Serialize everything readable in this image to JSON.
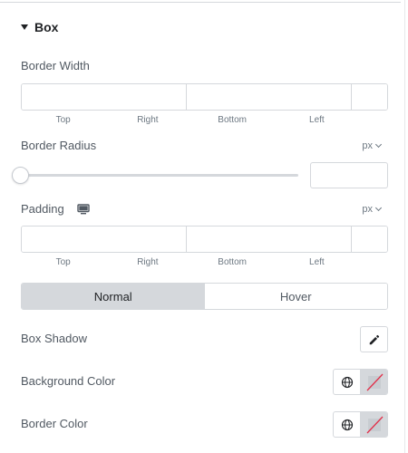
{
  "section": {
    "title": "Box",
    "toggle_icon": "caret-down-icon"
  },
  "border_width": {
    "label": "Border Width",
    "fields": [
      "Top",
      "Right",
      "Bottom",
      "Left"
    ],
    "values": [
      "",
      "",
      "",
      ""
    ],
    "link_icon": "link-icon"
  },
  "border_radius": {
    "label": "Border Radius",
    "unit": "px",
    "value": "",
    "slider_value": 0
  },
  "padding": {
    "label": "Padding",
    "device_icon": "desktop-icon",
    "unit": "px",
    "fields": [
      "Top",
      "Right",
      "Bottom",
      "Left"
    ],
    "values": [
      "",
      "",
      "",
      ""
    ],
    "link_icon": "link-icon"
  },
  "state_tabs": {
    "items": [
      "Normal",
      "Hover"
    ],
    "active": "Normal"
  },
  "box_shadow": {
    "label": "Box Shadow",
    "icon": "pencil-icon"
  },
  "background_color": {
    "label": "Background Color",
    "global_icon": "globe-icon",
    "swatch": "none"
  },
  "border_color": {
    "label": "Border Color",
    "global_icon": "globe-icon",
    "swatch": "none"
  },
  "colors": {
    "text": "#515962",
    "heading": "#1f2124",
    "border": "#d5d8dc",
    "clear_slash": "#e2304a"
  }
}
